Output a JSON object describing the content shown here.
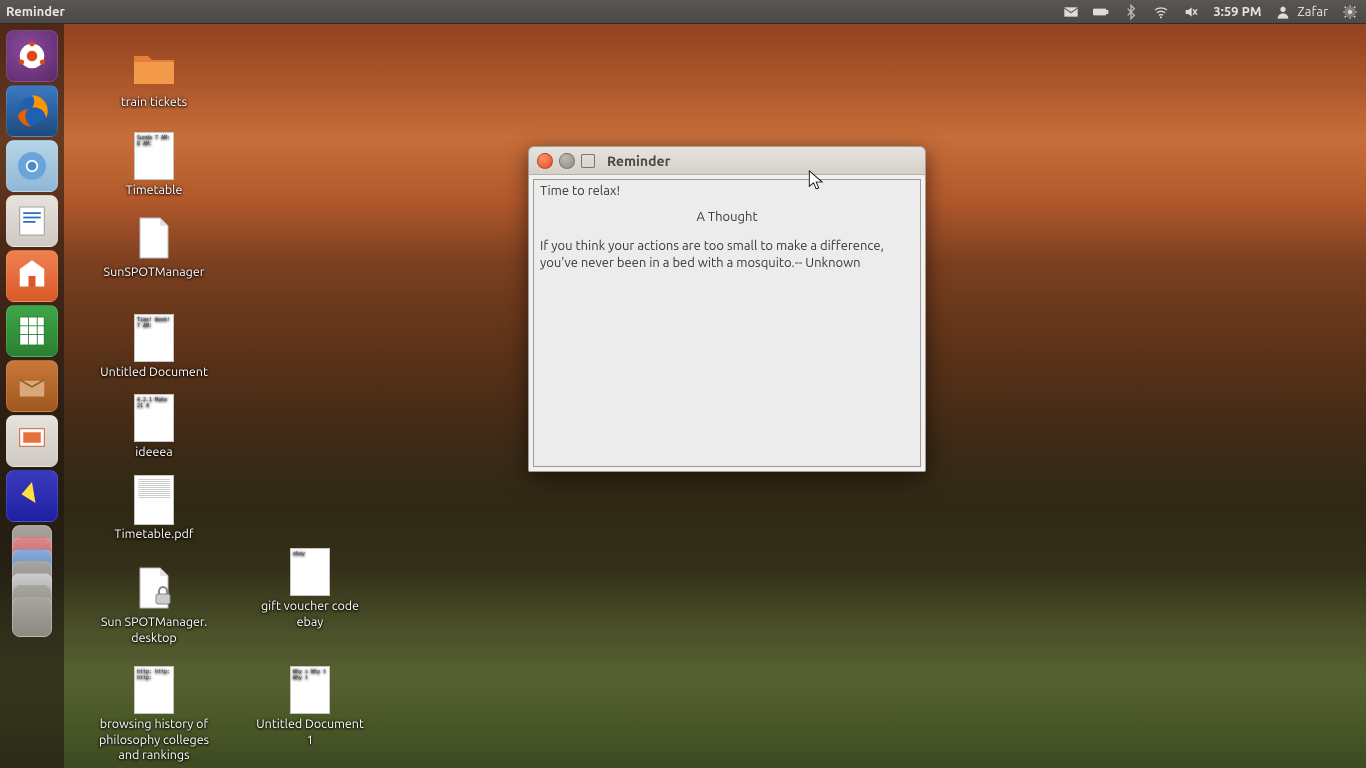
{
  "topbar": {
    "app_name": "Reminder",
    "clock": "3:59 PM",
    "user_name": "Zafar"
  },
  "desktop_icons": {
    "train_tickets": "train tickets",
    "timetable": "Timetable",
    "sunspot_mgr": "SunSPOTManager",
    "untitled_doc": "Untitled Document",
    "ideeea": "ideeea",
    "timetable_pdf": "Timetable.pdf",
    "sunspot_desktop": "Sun SPOTManager.\ndesktop",
    "browsing_history": "browsing history of\nphilosophy colleges\nand rankings",
    "gift_voucher": "gift voucher code\nebay",
    "untitled_doc_1": "Untitled Document\n1",
    "thumb_timetable": "Sunda\n7 AM:\n\n8 AM:",
    "thumb_untitled": "Time!\nWeek!\n7 AM:",
    "thumb_ideeea": "4.2.1\nMake\n\n21 4",
    "thumb_ebay": "ebay",
    "thumb_browsing": "http:\nhttp:\nhttp:",
    "thumb_untitled1": "Why s\nWhy t\nWhy t"
  },
  "reminder": {
    "title": "Reminder",
    "line1": "Time to relax!",
    "subhead": "A Thought",
    "quote": "If you think your actions are too small to make a difference, you've never been in a bed with a mosquito.-- Unknown"
  },
  "launcher": {
    "items": [
      "dash",
      "firefox",
      "chromium",
      "writer",
      "files",
      "calc",
      "update",
      "impress",
      "misc"
    ]
  }
}
